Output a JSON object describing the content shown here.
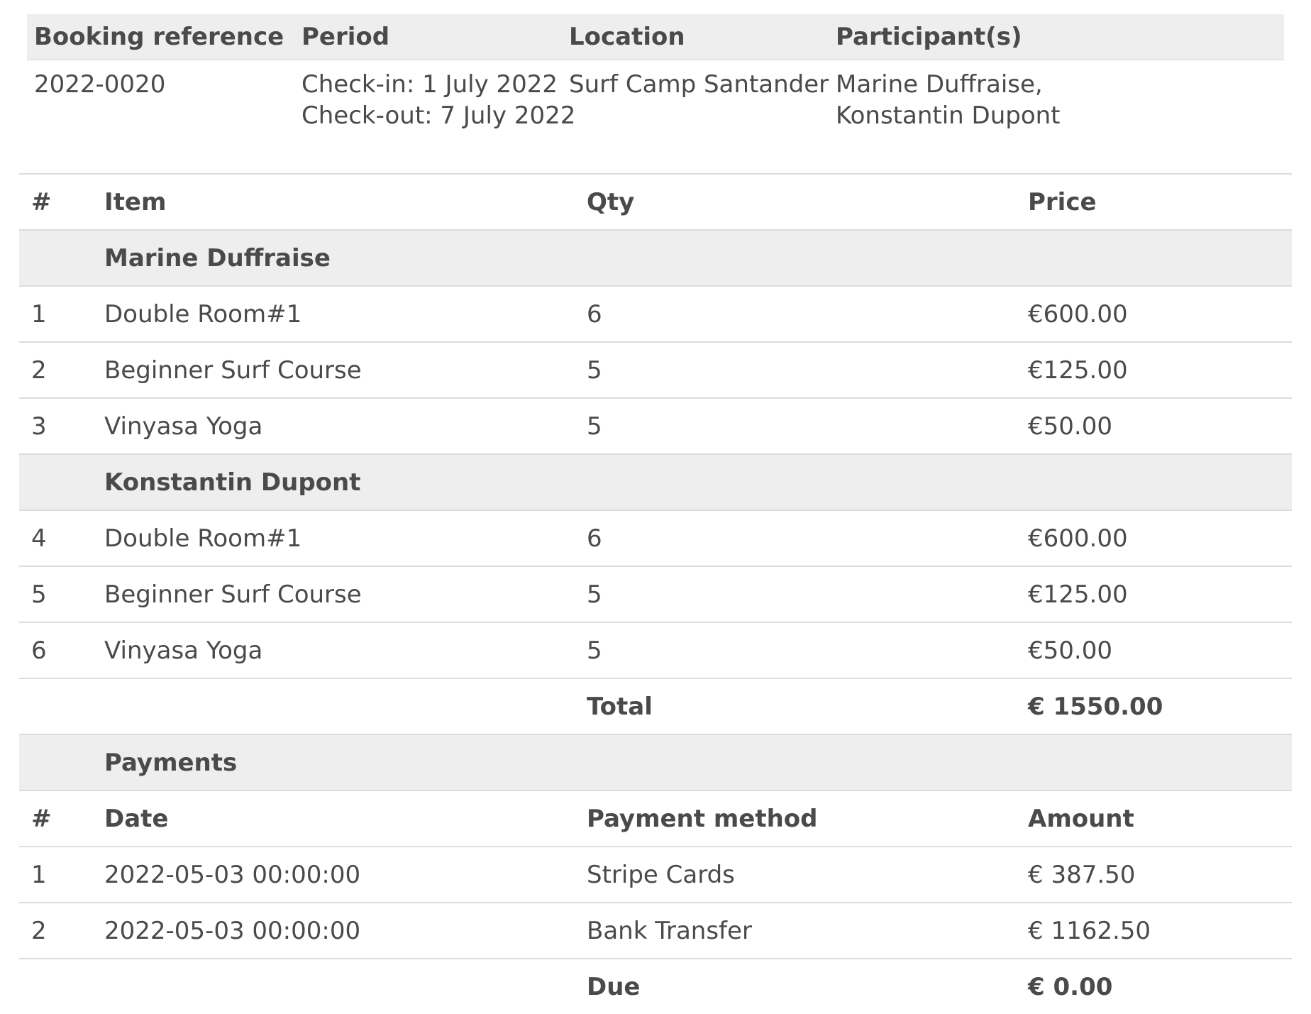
{
  "summary": {
    "headers": [
      "Booking reference",
      "Period",
      "Location",
      "Participant(s)"
    ],
    "booking_reference": "2022-0020",
    "period": {
      "check_in": "Check-in: 1 July 2022",
      "check_out": "Check-out: 7 July 2022"
    },
    "location": "Surf Camp Santander",
    "participants": [
      "Marine Duffraise,",
      "Konstantin Dupont"
    ]
  },
  "items": {
    "headers": [
      "#",
      "Item",
      "Qty",
      "Price"
    ],
    "groups": [
      {
        "name": "Marine Duffraise",
        "rows": [
          {
            "num": "1",
            "item": "Double Room#1",
            "qty": "6",
            "price": "€600.00"
          },
          {
            "num": "2",
            "item": "Beginner Surf Course",
            "qty": "5",
            "price": "€125.00"
          },
          {
            "num": "3",
            "item": "Vinyasa Yoga",
            "qty": "5",
            "price": "€50.00"
          }
        ]
      },
      {
        "name": "Konstantin Dupont",
        "rows": [
          {
            "num": "4",
            "item": "Double Room#1",
            "qty": "6",
            "price": "€600.00"
          },
          {
            "num": "5",
            "item": "Beginner Surf Course",
            "qty": "5",
            "price": "€125.00"
          },
          {
            "num": "6",
            "item": "Vinyasa Yoga",
            "qty": "5",
            "price": "€50.00"
          }
        ]
      }
    ],
    "total_label": "Total",
    "total_value": "€ 1550.00"
  },
  "payments": {
    "title": "Payments",
    "headers": [
      "#",
      "Date",
      "Payment method",
      "Amount"
    ],
    "rows": [
      {
        "num": "1",
        "date": "2022-05-03 00:00:00",
        "method": "Stripe Cards",
        "amount": "€ 387.50"
      },
      {
        "num": "2",
        "date": "2022-05-03 00:00:00",
        "method": "Bank Transfer",
        "amount": "€ 1162.50"
      }
    ],
    "due_label": "Due",
    "due_value": "€ 0.00"
  }
}
